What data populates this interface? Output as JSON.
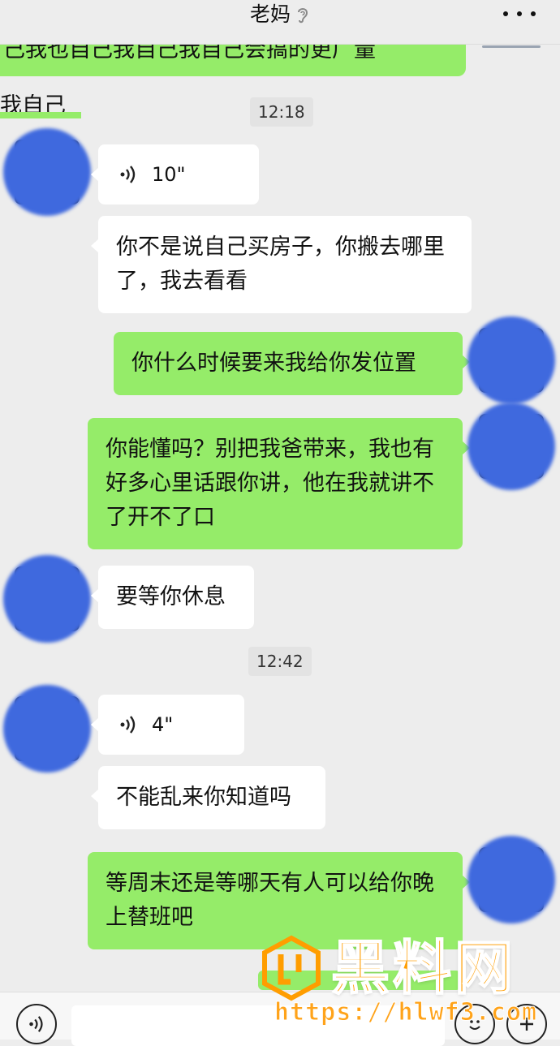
{
  "header": {
    "title": "老妈",
    "more_icon": "more-dots-icon",
    "ear_icon": "ear-icon"
  },
  "partial_top": {
    "text": "己我也自己我自己我自己会搞的更广量",
    "fragment": "我自己会"
  },
  "messages": {
    "time_1": "12:18",
    "voice_1": "10\"",
    "msg_1": "你不是说自己买房子，你搬去哪里了，我去看看",
    "msg_2": "你什么时候要来我给你发位置",
    "msg_3": "你能懂吗？别把我爸带来，我也有好多心里话跟你讲，他在我就讲不了开不了口",
    "msg_4": "要等你休息",
    "time_2": "12:42",
    "voice_2": "4\"",
    "msg_5": "不能乱来你知道吗",
    "msg_6": "等周末还是等哪天有人可以给你晚上替班吧"
  },
  "watermark": {
    "brand": "黑料网",
    "url": "https://hlwf3.com"
  },
  "colors": {
    "background": "#ededed",
    "incoming_bubble": "#ffffff",
    "outgoing_bubble": "#95ec69",
    "avatar_blur": "#3f69de",
    "watermark": "#ff9d00"
  }
}
